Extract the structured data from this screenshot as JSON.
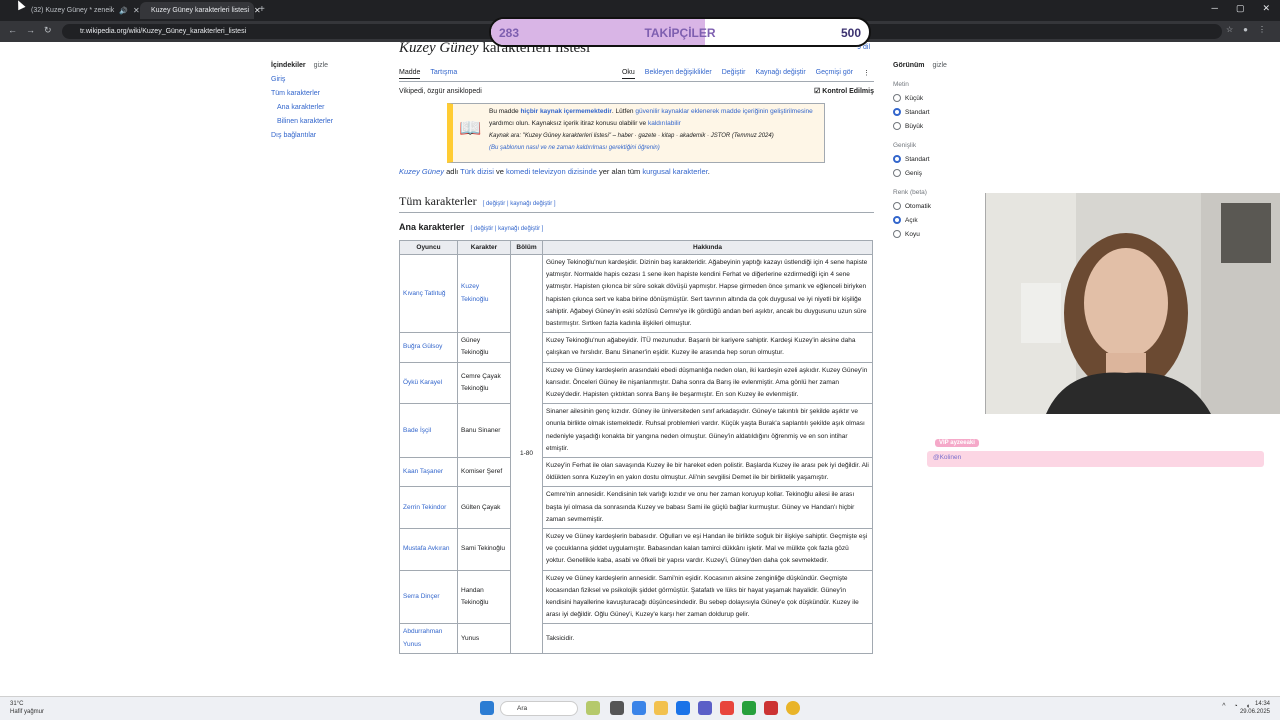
{
  "browser": {
    "tabs": [
      {
        "title": "(32) Kuzey Güney * zeneik",
        "active": false
      },
      {
        "title": "Kuzey Güney karakterleri listesi",
        "active": true
      }
    ],
    "url": "tr.wikipedia.org/wiki/Kuzey_Güney_karakterleri_listesi"
  },
  "follower_goal": {
    "current": "283",
    "label": "TAKİPÇİLER",
    "goal": "500",
    "progress": 0.566
  },
  "toc": {
    "title": "İçindekiler",
    "hide": "gizle",
    "items": [
      "Giriş",
      "Tüm karakterler",
      "Ana karakterler",
      "Bilinen karakterler",
      "Dış bağlantılar"
    ]
  },
  "article": {
    "title_italic": "Kuzey Güney",
    "title_rest": " karakterleri listesi",
    "lang_button": "9 dil",
    "tabs_left": [
      "Madde",
      "Tartışma"
    ],
    "tabs_right": [
      "Oku",
      "Bekleyen değişiklikler",
      "Değiştir",
      "Kaynağı değiştir",
      "Geçmişi gör"
    ],
    "tagline": "Vikipedi, özgür ansiklopedi",
    "checked": "Kontrol Edilmiş",
    "notice_line1_a": "Bu madde ",
    "notice_line1_b": "hiçbir kaynak içermemektedir",
    "notice_line1_c": ". Lütfen ",
    "notice_line1_d": "güvenilir kaynaklar eklenerek madde içeriğinin geliştirilmesine",
    "notice_line1_e": " yardımcı olun. Kaynaksız içerik itiraz konusu olabilir ve ",
    "notice_line1_f": "kaldırılabilir",
    "notice_line2": "Kaynak ara: \"Kuzey Güney karakterleri listesi\" – haber · gazete · kitap · akademik · JSTOR (Temmuz 2024)",
    "notice_line3": "(Bu şablonun nasıl ve ne zaman kaldırılması gerektiğini öğrenin)",
    "intro_a": "Kuzey Güney",
    "intro_b": " adlı ",
    "intro_c": "Türk dizisi",
    "intro_d": " ve ",
    "intro_e": "komedi televizyon dizisinde",
    "intro_f": " yer alan tüm ",
    "intro_g": "kurgusal karakterler",
    "intro_h": ".",
    "section_all": "Tüm karakterler",
    "section_main": "Ana karakterler",
    "edit_links": "[ değiştir | kaynağı değiştir ]",
    "table_headers": [
      "Oyuncu",
      "Karakter",
      "Bölüm",
      "Hakkında"
    ],
    "episode_range": "1-80",
    "rows": [
      {
        "actor": "Kıvanç Tatlıtuğ",
        "character": "Kuzey Tekinoğlu",
        "char_link": true,
        "about": "Güney Tekinoğlu'nun kardeşidir. Dizinin baş karakteridir. Ağabeyinin yaptığı kazayı üstlendiği için 4 sene hapiste yatmıştır. Normalde hapis cezası 1 sene iken hapiste kendini Ferhat ve diğerlerine ezdirmediği için 4 sene yatmıştır. Hapisten çıkınca bir süre sokak dövüşü yapmıştır. Hapse girmeden önce şımarık ve eğlenceli biriyken hapisten çıkınca sert ve kaba birine dönüşmüştür. Sert tavrının altında da çok duygusal ve iyi niyetli bir kişiliğe sahiptir. Ağabeyi Güney'in eski sözlüsü Cemre'ye ilk gördüğü andan beri aşıktır, ancak bu duygusunu uzun süre bastırmıştır. Sırtken fazla kadınla ilişkileri olmuştur."
      },
      {
        "actor": "Buğra Gülsoy",
        "character": "Güney Tekinoğlu",
        "char_link": false,
        "about": "Kuzey Tekinoğlu'nun ağabeyidir. İTÜ mezunudur. Başarılı bir kariyere sahiptir. Kardeşi Kuzey'in aksine daha çalışkan ve hırslıdır. Banu Sinaner'in eşidir. Kuzey ile arasında hep sorun olmuştur."
      },
      {
        "actor": "Öykü Karayel",
        "character": "Cemre Çayak Tekinoğlu",
        "char_link": false,
        "about": "Kuzey ve Güney kardeşlerin arasındaki ebedi düşmanlığa neden olan, iki kardeşin ezeli aşkıdır. Kuzey Güney'in karısıdır. Önceleri Güney ile nişanlanmıştır. Daha sonra da Barış ile evlenmiştir. Ama gönlü her zaman Kuzey'dedir. Hapisten çıktıktan sonra Barış ile beşarmıştır. En son Kuzey ile evlenmiştir."
      },
      {
        "actor": "Bade İşçil",
        "character": "Banu Sinaner",
        "char_link": false,
        "about": "Sinaner ailesinin genç kızıdır. Güney ile üniversiteden sınıf arkadaşıdır. Güney'e takıntılı bir şekilde aşıktır ve onunla birlikte olmak istemektedir. Ruhsal problemleri vardır. Küçük yaşta Burak'a saplantılı şekilde aşık olması nedeniyle yaşadığı konakta bir yangına neden olmuştur. Güney'in aldatıldığını öğrenmiş ve en son intihar etmiştir."
      },
      {
        "actor": "Kaan Taşaner",
        "character": "Komiser Şeref",
        "char_link": false,
        "about": "Kuzey'in Ferhat ile olan savaşında Kuzey ile bir hareket eden polistir. Başlarda Kuzey ile arası pek iyi değildir. Ali öldükten sonra Kuzey'in en yakın dostu olmuştur. Ali'nin sevgilisi Demet ile bir birliktelik yaşamıştır."
      },
      {
        "actor": "Zerrin Tekindor",
        "character": "Gülten Çayak",
        "char_link": false,
        "about": "Cemre'nin annesidir. Kendisinin tek varlığı kızıdır ve onu her zaman koruyup kollar. Tekinoğlu ailesi ile arası başta iyi olmasa da sonrasında Kuzey ve babası Sami ile güçlü bağlar kurmuştur. Güney ve Handan'ı hiçbir zaman sevmemiştir."
      },
      {
        "actor": "Mustafa Avkıran",
        "character": "Sami Tekinoğlu",
        "char_link": false,
        "about": "Kuzey ve Güney kardeşlerin babasıdır. Oğulları ve eşi Handan ile birlikte soğuk bir ilişkiye sahiptir. Geçmişte eşi ve çocuklarına şiddet uygulamıştır. Babasından kalan tamirci dükkânı işletir. Mal ve mülkte çok fazla gözü yoktur. Genellikle kaba, asabi ve öfkeli bir yapısı vardır. Kuzey'i, Güney'den daha çok sevmektedir."
      },
      {
        "actor": "Serra Dinçer",
        "character": "Handan Tekinoğlu",
        "char_link": false,
        "about": "Kuzey ve Güney kardeşlerin annesidir. Sami'nin eşidir. Kocasının aksine zenginliğe düşkündür. Geçmişte kocasından fiziksel ve psikolojik şiddet görmüştür. Şatafatlı ve lüks bir hayat yaşamak hayalidir. Güney'in kendisini hayallerine kavuşturacağı düşüncesindedir. Bu sebep dolayısıyla Güney'e çok düşkündür. Kuzey ile arası iyi değildir. Oğlu Güney'i, Kuzey'e karşı her zaman doldurup gelir."
      },
      {
        "actor": "Abdurrahman Yunus",
        "character": "Yunus",
        "char_link": false,
        "about": "Taksicidir."
      }
    ]
  },
  "appearance": {
    "title": "Görünüm",
    "hide": "gizle",
    "text_label": "Metin",
    "text_options": [
      "Küçük",
      "Standart",
      "Büyük"
    ],
    "width_label": "Genişlik",
    "width_options": [
      "Standart",
      "Geniş"
    ],
    "color_label": "Renk (beta)",
    "color_options": [
      "Otomatik",
      "Açık",
      "Koyu"
    ]
  },
  "chat": {
    "badge": "VIP ayzeeaki",
    "message": "@Kolinen"
  },
  "taskbar": {
    "weather_temp": "31°C",
    "weather_desc": "Hafif yağmur",
    "search": "Ara",
    "time": "14:34",
    "date": "29.06.2025"
  },
  "colors": {
    "link": "#3366cc",
    "follow_fill": "#d9b5e6",
    "chat_bg": "#fcd6e4"
  }
}
